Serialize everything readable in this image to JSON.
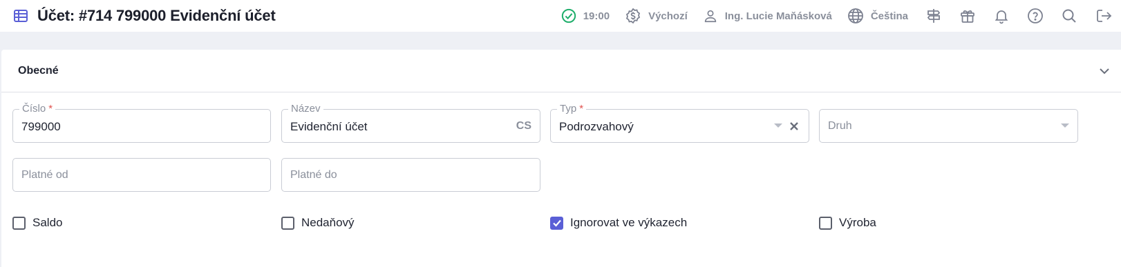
{
  "header": {
    "title": "Účet: #714 799000 Evidenční účet",
    "time": "19:00",
    "pricelist": "Výchozí",
    "user": "Ing. Lucie Maňásková",
    "language": "Čeština",
    "icons": [
      "table-icon",
      "check-circle-icon",
      "dollar-badge-icon",
      "user-icon",
      "globe-icon",
      "signpost-icon",
      "gift-icon",
      "bell-icon",
      "help-icon",
      "search-icon",
      "logout-icon"
    ]
  },
  "section": {
    "title": "Obecné"
  },
  "fields": {
    "cislo": {
      "label": "Číslo",
      "required": "*",
      "value": "799000"
    },
    "nazev": {
      "label": "Název",
      "value": "Evidenční účet",
      "suffix": "CS"
    },
    "typ": {
      "label": "Typ",
      "required": "*",
      "value": "Podrozvahový"
    },
    "druh": {
      "placeholder": "Druh"
    },
    "platne_od": {
      "placeholder": "Platné od"
    },
    "platne_do": {
      "placeholder": "Platné do"
    }
  },
  "checkboxes": [
    {
      "label": "Saldo",
      "checked": false
    },
    {
      "label": "Nedaňový",
      "checked": false
    },
    {
      "label": "Ignorovat ve výkazech",
      "checked": true
    },
    {
      "label": "Výroba",
      "checked": false
    }
  ],
  "colors": {
    "accent": "#5a5fd6",
    "status_ok": "#1fae6b",
    "required": "#e0524f"
  }
}
